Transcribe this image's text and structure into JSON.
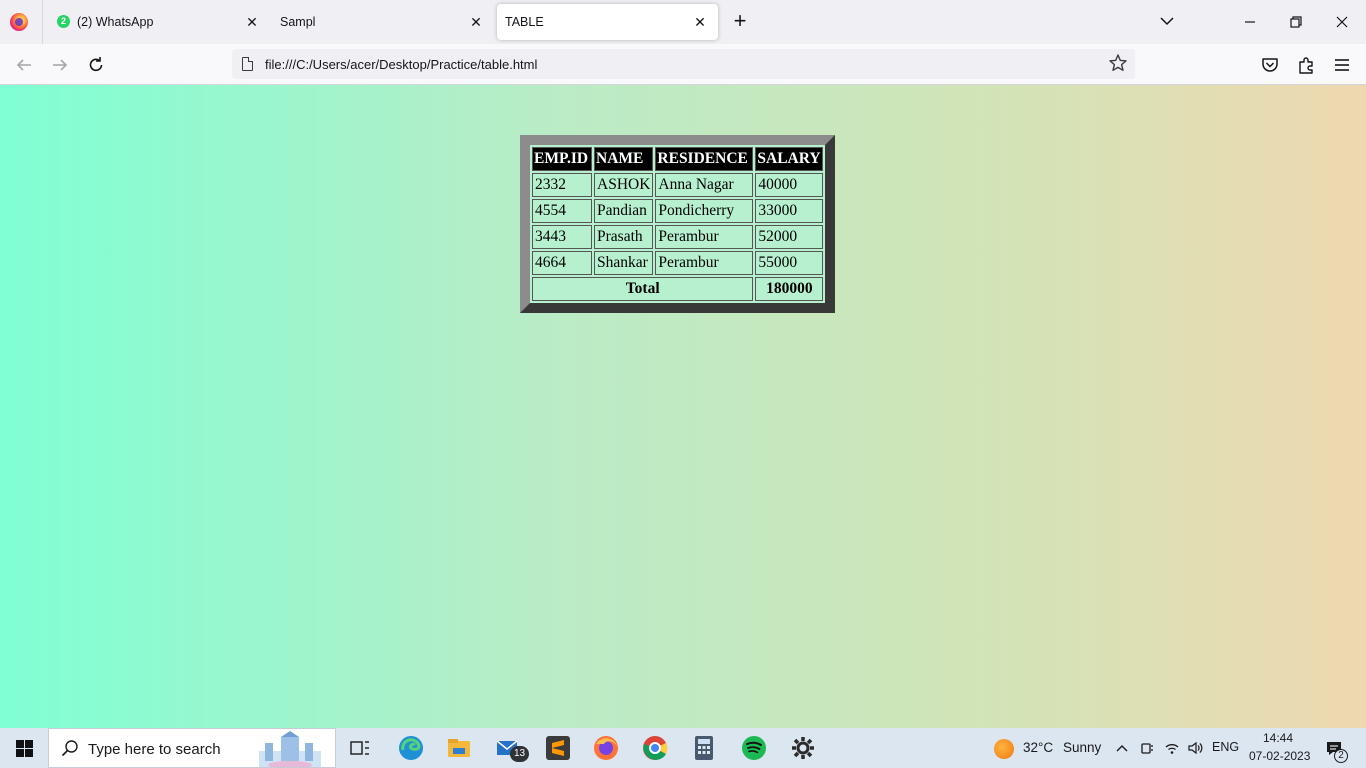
{
  "browser": {
    "tabs": [
      {
        "title": "(2) WhatsApp",
        "badge": "2"
      },
      {
        "title": "Sampl"
      },
      {
        "title": "TABLE"
      }
    ],
    "close_glyph": "✕",
    "new_tab_glyph": "+",
    "url": "file:///C:/Users/acer/Desktop/Practice/table.html"
  },
  "table": {
    "headers": [
      "EMP.ID",
      "NAME",
      "RESIDENCE",
      "SALARY"
    ],
    "rows": [
      [
        "2332",
        "ASHOK",
        "Anna Nagar",
        "40000"
      ],
      [
        "4554",
        "Pandian",
        "Pondicherry",
        "33000"
      ],
      [
        "3443",
        "Prasath",
        "Perambur",
        "52000"
      ],
      [
        "4664",
        "Shankar",
        "Perambur",
        "55000"
      ]
    ],
    "total_label": "Total",
    "total_value": "180000"
  },
  "taskbar": {
    "search_placeholder": "Type here to search",
    "mail_badge": "13",
    "weather_temp": "32°C",
    "weather_desc": "Sunny",
    "language": "ENG",
    "time": "14:44",
    "date": "07-02-2023",
    "notification_count": "2"
  },
  "colors": {
    "gradient_start": "#7fffd4",
    "gradient_end": "#efd8b0",
    "table_bg": "#b6f0cf",
    "header_bg": "#000000"
  }
}
